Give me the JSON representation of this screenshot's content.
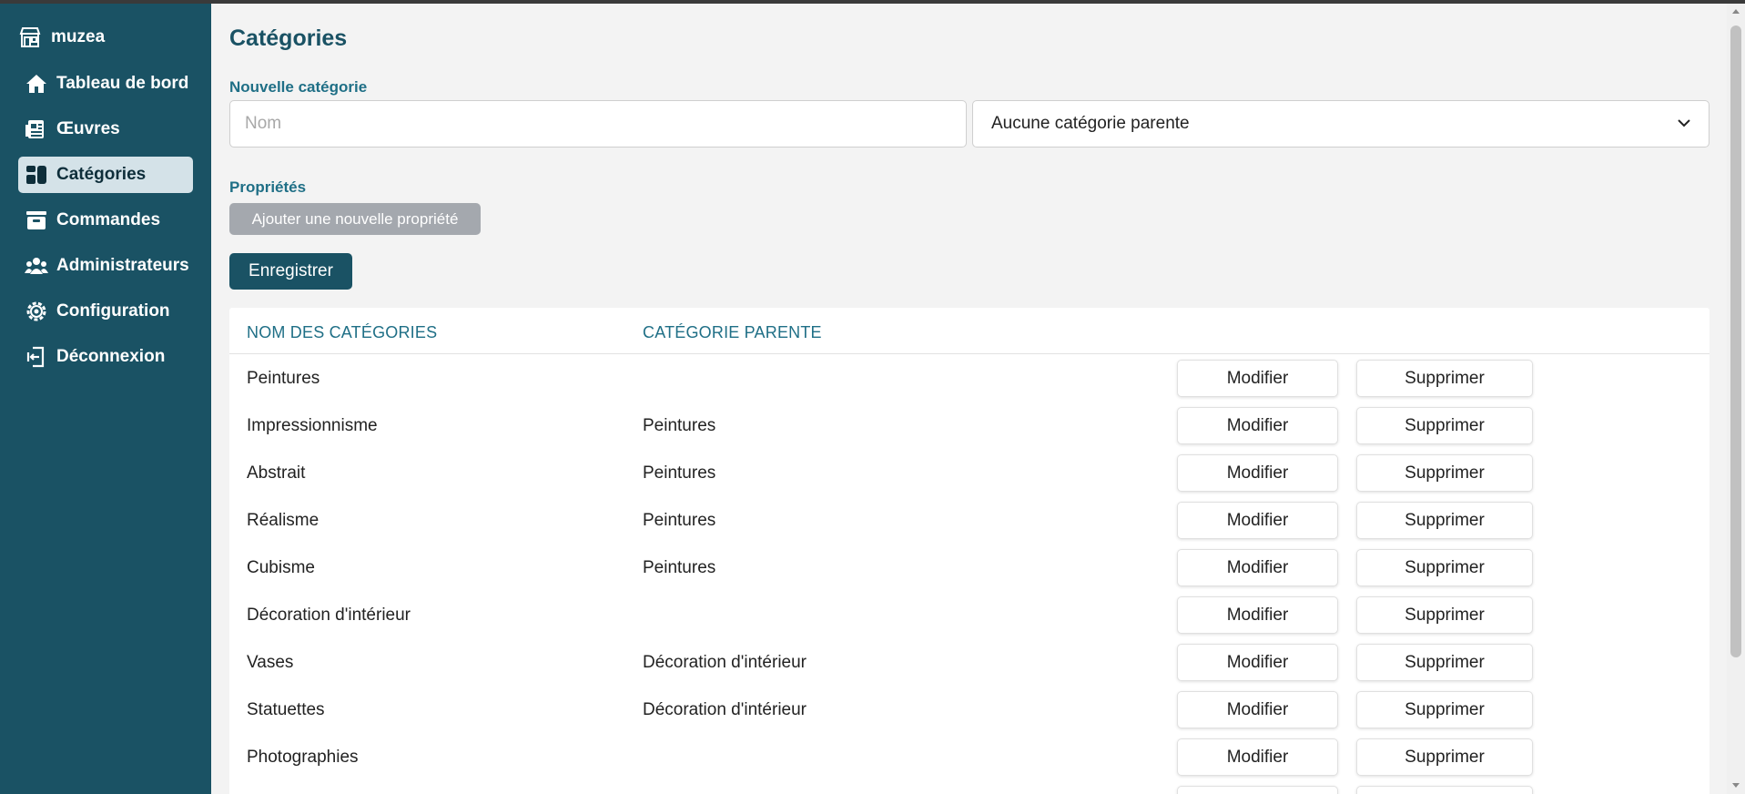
{
  "app": {
    "brand": "muzea"
  },
  "sidebar": {
    "items": [
      {
        "label": "Tableau de bord",
        "icon": "home-icon"
      },
      {
        "label": "Œuvres",
        "icon": "newspaper-icon"
      },
      {
        "label": "Catégories",
        "icon": "categories-icon",
        "active": true
      },
      {
        "label": "Commandes",
        "icon": "orders-icon"
      },
      {
        "label": "Administrateurs",
        "icon": "users-icon"
      },
      {
        "label": "Configuration",
        "icon": "gear-icon"
      },
      {
        "label": "Déconnexion",
        "icon": "logout-icon"
      }
    ]
  },
  "page": {
    "title": "Catégories",
    "new_category_label": "Nouvelle catégorie",
    "name_placeholder": "Nom",
    "parent_select_value": "Aucune catégorie parente",
    "properties_label": "Propriétés",
    "add_property_button": "Ajouter une nouvelle propriété",
    "save_button": "Enregistrer"
  },
  "table": {
    "headers": {
      "name": "NOM DES CATÉGORIES",
      "parent": "CATÉGORIE PARENTE"
    },
    "edit_label": "Modifier",
    "delete_label": "Supprimer",
    "rows": [
      {
        "name": "Peintures",
        "parent": ""
      },
      {
        "name": "Impressionnisme",
        "parent": "Peintures"
      },
      {
        "name": "Abstrait",
        "parent": "Peintures"
      },
      {
        "name": "Réalisme",
        "parent": "Peintures"
      },
      {
        "name": "Cubisme",
        "parent": "Peintures"
      },
      {
        "name": "Décoration d'intérieur",
        "parent": ""
      },
      {
        "name": "Vases",
        "parent": "Décoration d'intérieur"
      },
      {
        "name": "Statuettes",
        "parent": "Décoration d'intérieur"
      },
      {
        "name": "Photographies",
        "parent": ""
      },
      {
        "name": "",
        "parent": ""
      }
    ]
  },
  "colors": {
    "sidebar_bg": "#1a5264",
    "accent": "#1f6f86",
    "active_item_bg": "#d4e2e8",
    "add_property_bg": "#a4a8ae"
  }
}
